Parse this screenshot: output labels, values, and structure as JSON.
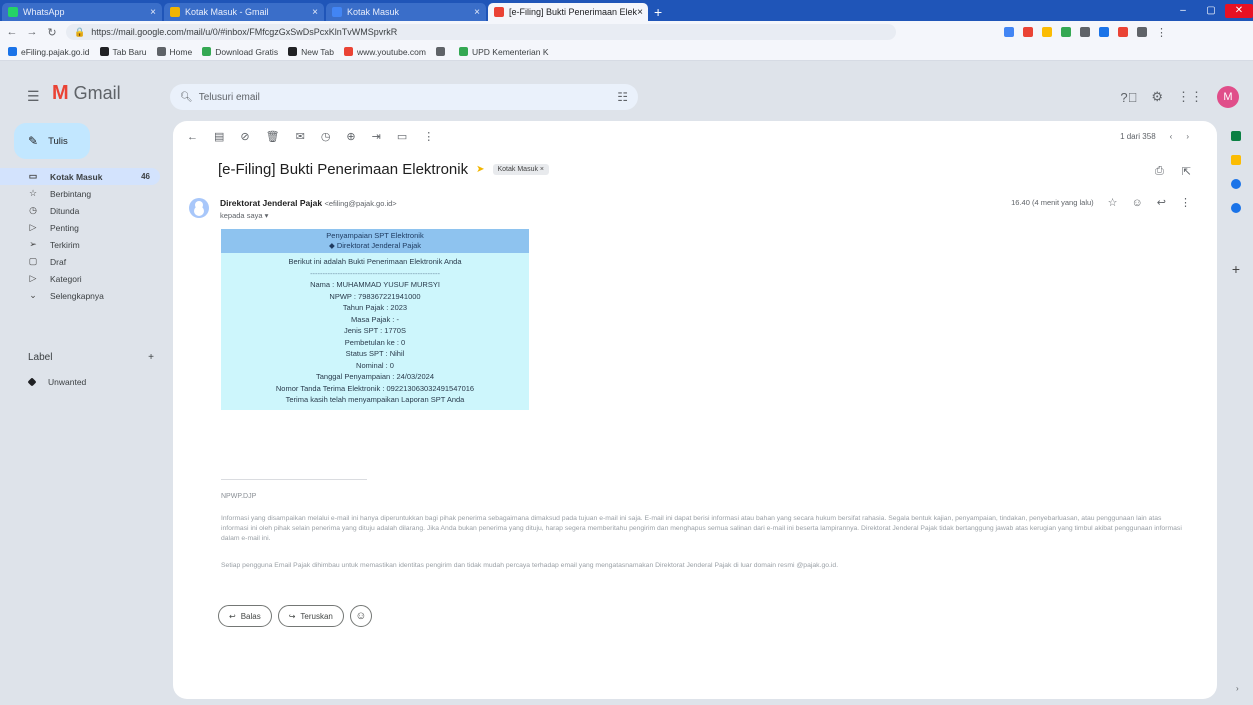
{
  "browser": {
    "tabs": [
      {
        "label": "WhatsApp",
        "color": "#25d366",
        "active": false
      },
      {
        "label": "Kotak Masuk - Gmail",
        "color": "#f0b400",
        "active": false
      },
      {
        "label": "Kotak Masuk",
        "color": "#4285f4",
        "active": false
      },
      {
        "label": "[e-Filing] Bukti Penerimaan Elek",
        "color": "#ea4335",
        "active": true
      }
    ],
    "new_tab": "+",
    "url": "https://mail.google.com/mail/u/0/#inbox/FMfcgzGxSwDsPcxKlnTvWMSpvrkR",
    "bookmarks": [
      {
        "label": "eFiling.pajak.go.id",
        "color": "#1a73e8"
      },
      {
        "label": "Tab Baru",
        "color": "#202124"
      },
      {
        "label": "Home",
        "color": "#5f6368"
      },
      {
        "label": "Download Gratis",
        "color": "#34a853"
      },
      {
        "label": "New Tab",
        "color": "#202124"
      },
      {
        "label": "www.youtube.com",
        "color": "#ea4335"
      },
      {
        "label": "",
        "color": "#5f6368"
      },
      {
        "label": "UPD Kementerian K",
        "color": "#34a853"
      }
    ],
    "extension_colors": [
      "#4285f4",
      "#ea4335",
      "#fbbc04",
      "#34a853",
      "#5f6368",
      "#1a73e8",
      "#ea4335",
      "#5f6368"
    ]
  },
  "header": {
    "app_name": "Gmail",
    "search_placeholder": "Telusuri email"
  },
  "sidebar": {
    "compose_label": "Tulis",
    "items": [
      {
        "label": "Kotak Masuk",
        "icon": "inbox-icon",
        "glyph": "▭",
        "count": "46",
        "active": true
      },
      {
        "label": "Berbintang",
        "icon": "star-icon",
        "glyph": "☆",
        "count": "",
        "active": false
      },
      {
        "label": "Ditunda",
        "icon": "clock-icon",
        "glyph": "◷",
        "count": "",
        "active": false
      },
      {
        "label": "Penting",
        "icon": "important-icon",
        "glyph": "▷",
        "count": "",
        "active": false
      },
      {
        "label": "Terkirim",
        "icon": "send-icon",
        "glyph": "➢",
        "count": "",
        "active": false
      },
      {
        "label": "Draf",
        "icon": "draft-icon",
        "glyph": "▢",
        "count": "",
        "active": false
      },
      {
        "label": "Kategori",
        "icon": "label-icon",
        "glyph": "▷",
        "count": "",
        "active": false
      },
      {
        "label": "Selengkapnya",
        "icon": "chevron-down-icon",
        "glyph": "⌄",
        "count": "",
        "active": false
      }
    ],
    "labels_title": "Label",
    "labels_add": "+",
    "label_items": [
      {
        "label": "Unwanted"
      }
    ]
  },
  "message": {
    "pager_text": "1 dari 358",
    "subject": "[e-Filing] Bukti Penerimaan Elektronik",
    "folder_chip": "Kotak Masuk ×",
    "sender_name": "Direktorat Jenderal Pajak",
    "sender_email": "<efiling@pajak.go.id>",
    "recipient": "kepada saya ▾",
    "time": "16.40 (4 menit yang lalu)",
    "receipt": {
      "header_lines": [
        "Penyampaian SPT Elektronik",
        "◆ Direktorat Jenderal Pajak"
      ],
      "intro": "Berikut ini adalah Bukti Penerimaan Elektronik Anda",
      "separator": "----------------------------------------------------",
      "lines": [
        "Nama : MUHAMMAD YUSUF MURSYI",
        "NPWP : 798367221941000",
        "Tahun Pajak : 2023",
        "Masa Pajak : -",
        "Jenis SPT : 1770S",
        "Pembetulan ke : 0",
        "Status SPT : Nihil",
        "Nominal : 0",
        "Tanggal Penyampaian : 24/03/2024",
        "Nomor Tanda Terima Elektronik : 092213063032491547016",
        "Terima kasih telah menyampaikan Laporan SPT Anda"
      ]
    },
    "footer_title": "NPWP.DJP",
    "footer_paragraph": "Informasi yang disampaikan melalui e-mail ini hanya diperuntukkan bagi pihak penerima sebagaimana dimaksud pada tujuan e-mail ini saja. E-mail ini dapat berisi informasi atau bahan yang secara hukum bersifat rahasia. Segala bentuk kajian, penyampaian, tindakan, penyebarluasan, atau penggunaan lain atas informasi ini oleh pihak selain penerima yang dituju adalah dilarang. Jika Anda bukan penerima yang dituju, harap segera memberitahu pengirim dan menghapus semua salinan dari e-mail ini beserta lampirannya. Direktorat Jenderal Pajak tidak bertanggung jawab atas kerugian yang timbul akibat penggunaan informasi dalam e-mail ini.",
    "footer_note": "Setiap pengguna Email Pajak dihimbau untuk memastikan identitas pengirim dan tidak mudah percaya terhadap email yang mengatasnamakan Direktorat Jenderal Pajak di luar domain resmi @pajak.go.id.",
    "reply_label": "Balas",
    "forward_label": "Teruskan"
  },
  "side_panel": {
    "colors": [
      "#0b8043",
      "#fbbc04",
      "#1a73e8",
      "#1a73e8"
    ]
  }
}
